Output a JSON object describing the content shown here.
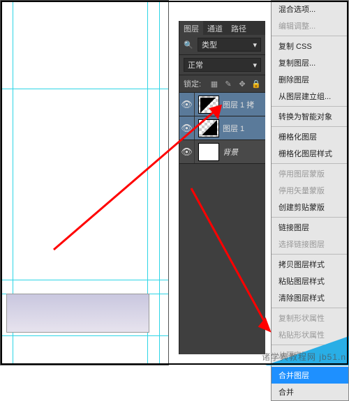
{
  "tabs": {
    "layers": "图层",
    "channels": "通道",
    "paths": "路径"
  },
  "kind_label": "类型",
  "blend_mode": "正常",
  "lock_label": "锁定:",
  "layers": [
    {
      "name": "图层 1 拷"
    },
    {
      "name": "图层 1"
    },
    {
      "name": "背景"
    }
  ],
  "menu": {
    "blend_options": "混合选项...",
    "edit_adjust": "编辑调整...",
    "copy_css": "复制 CSS",
    "dup_layer": "复制图层...",
    "del_layer": "删除图层",
    "group_from": "从图层建立组...",
    "to_smart": "转换为智能对象",
    "rasterize": "栅格化图层",
    "rasterize_style": "栅格化图层样式",
    "disable_mask": "停用图层蒙版",
    "disable_vmask": "停用矢量蒙版",
    "create_clip": "创建剪贴蒙版",
    "link": "链接图层",
    "select_linked": "选择链接图层",
    "copy_style": "拷贝图层样式",
    "paste_style": "粘贴图层样式",
    "clear_style": "清除图层样式",
    "copy_shape_attr": "复制形状属性",
    "paste_shape_attr": "粘贴形状属性",
    "release_iso": "从隔离图层释放",
    "merge_layers": "合并图层",
    "merge_visible_partial": "合并"
  },
  "watermark": "诸学典教程网 jb51.n"
}
